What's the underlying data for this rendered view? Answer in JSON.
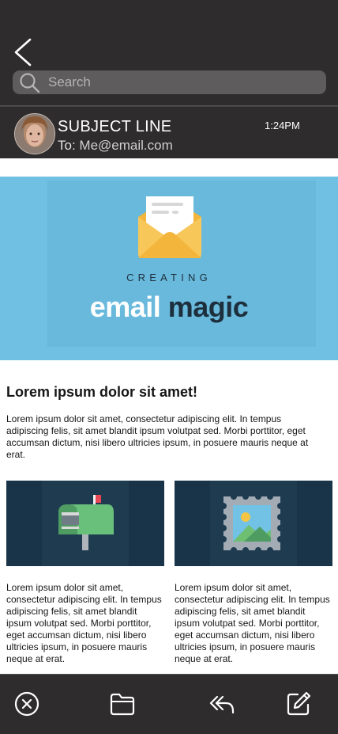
{
  "header": {
    "search_placeholder": "Search",
    "subject": "SUBJECT LINE",
    "to_label": "To:",
    "to_address": "Me@email.com",
    "time": "1:24PM"
  },
  "hero": {
    "creating": "CREATING",
    "brand_word1": "email",
    "brand_word2": "magic"
  },
  "body": {
    "headline": "Lorem ipsum dolor sit amet!",
    "paragraph": "Lorem ipsum dolor sit amet, consectetur adipiscing elit. In tempus adipiscing felis, sit amet blandit ipsum volutpat sed. Morbi porttitor, eget accumsan dictum, nisi libero ultricies ipsum, in posuere mauris neque at erat.",
    "col_left": "Lorem ipsum dolor sit amet, consectetur adipiscing elit. In tempus adipiscing felis, sit amet blandit ipsum volutpat sed. Morbi porttitor, eget accumsan dictum, nisi libero ultricies ipsum, in posuere mauris neque at erat.",
    "col_right": "Lorem ipsum dolor sit amet, consectetur adipiscing elit. In tempus adipiscing felis, sit amet blandit ipsum volutpat sed. Morbi porttitor, eget accumsan dictum, nisi libero ultricies ipsum, in posuere mauris neque at erat."
  },
  "icons": {
    "back": "chevron-left-icon",
    "search": "search-icon",
    "envelope": "envelope-icon",
    "mailbox": "mailbox-icon",
    "stamp": "stamp-icon",
    "delete": "close-circle-icon",
    "folder": "folder-icon",
    "reply": "reply-icon",
    "compose": "compose-icon"
  },
  "colors": {
    "bar": "#2e2c2c",
    "hero": "#6fc0e3",
    "card": "#193448",
    "brand_dark": "#1d2f3d"
  }
}
